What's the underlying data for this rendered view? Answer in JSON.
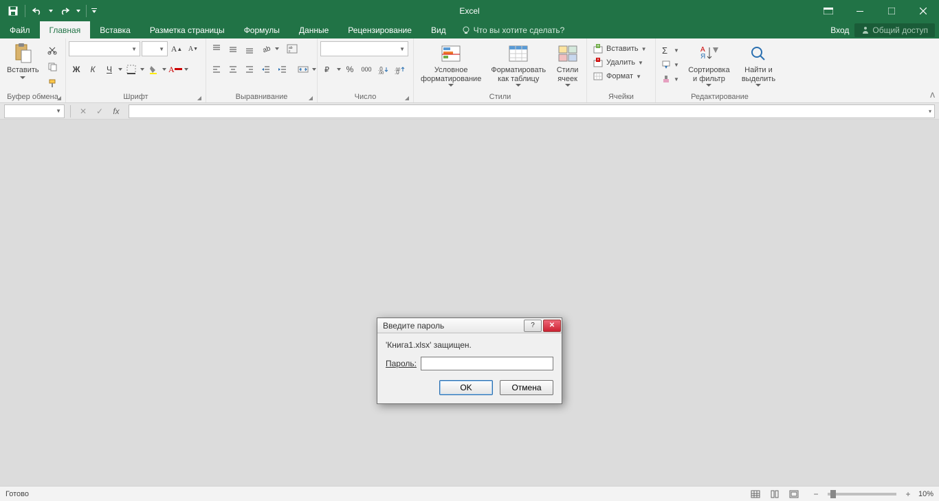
{
  "app": {
    "title": "Excel"
  },
  "tabs": {
    "file": "Файл",
    "items": [
      "Главная",
      "Вставка",
      "Разметка страницы",
      "Формулы",
      "Данные",
      "Рецензирование",
      "Вид"
    ],
    "active_index": 0,
    "tellme": "Что вы хотите сделать?",
    "login": "Вход",
    "share": "Общий доступ"
  },
  "ribbon": {
    "clipboard": {
      "label": "Буфер обмена",
      "paste": "Вставить"
    },
    "font": {
      "label": "Шрифт",
      "font_name": "",
      "font_size": "",
      "bold": "Ж",
      "italic": "К",
      "underline": "Ч"
    },
    "alignment": {
      "label": "Выравнивание"
    },
    "number": {
      "label": "Число",
      "format": "",
      "percent": "%",
      "thousands": "000"
    },
    "styles": {
      "label": "Стили",
      "conditional": "Условное форматирование",
      "as_table": "Форматировать как таблицу",
      "cell_styles": "Стили ячеек"
    },
    "cells": {
      "label": "Ячейки",
      "insert": "Вставить",
      "delete": "Удалить",
      "format": "Формат"
    },
    "editing": {
      "label": "Редактирование",
      "sort": "Сортировка и фильтр",
      "find": "Найти и выделить"
    }
  },
  "dialog": {
    "title": "Введите пароль",
    "message": "'Книга1.xlsx' защищен.",
    "password_label": "Пароль:",
    "ok": "OK",
    "cancel": "Отмена"
  },
  "status": {
    "ready": "Готово",
    "zoom": "10%"
  }
}
